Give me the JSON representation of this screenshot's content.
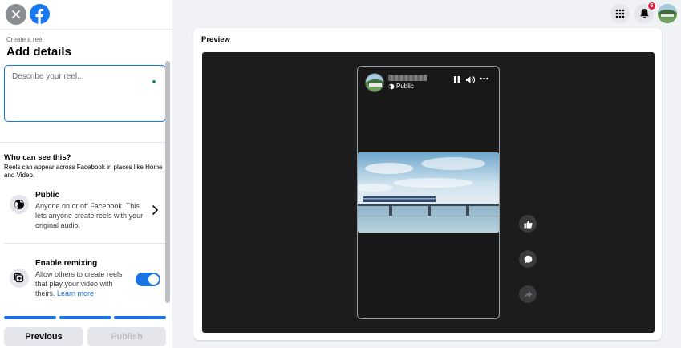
{
  "sidebar": {
    "breadcrumb": "Create a reel",
    "title": "Add details",
    "description_placeholder": "Describe your reel...",
    "audience": {
      "heading": "Who can see this?",
      "note": "Reels can appear across Facebook in places like Home and Video.",
      "option_title": "Public",
      "option_desc": "Anyone on or off Facebook. This lets anyone create reels with your original audio."
    },
    "remix": {
      "title": "Enable remixing",
      "desc": "Allow others to create reels that play your video with theirs.",
      "learn_more": "Learn more",
      "enabled": true
    },
    "progress_steps": 3,
    "previous_label": "Previous",
    "publish_label": "Publish"
  },
  "topnav": {
    "notification_count": "6",
    "icons": [
      "apps-grid-icon",
      "bell-icon",
      "avatar"
    ]
  },
  "preview": {
    "label": "Preview",
    "privacy": "Public",
    "actions": [
      "like-icon",
      "comment-icon",
      "share-icon"
    ]
  },
  "colors": {
    "accent": "#1b74e4",
    "badge": "#e41e3f",
    "stage": "#1c1c1c"
  }
}
